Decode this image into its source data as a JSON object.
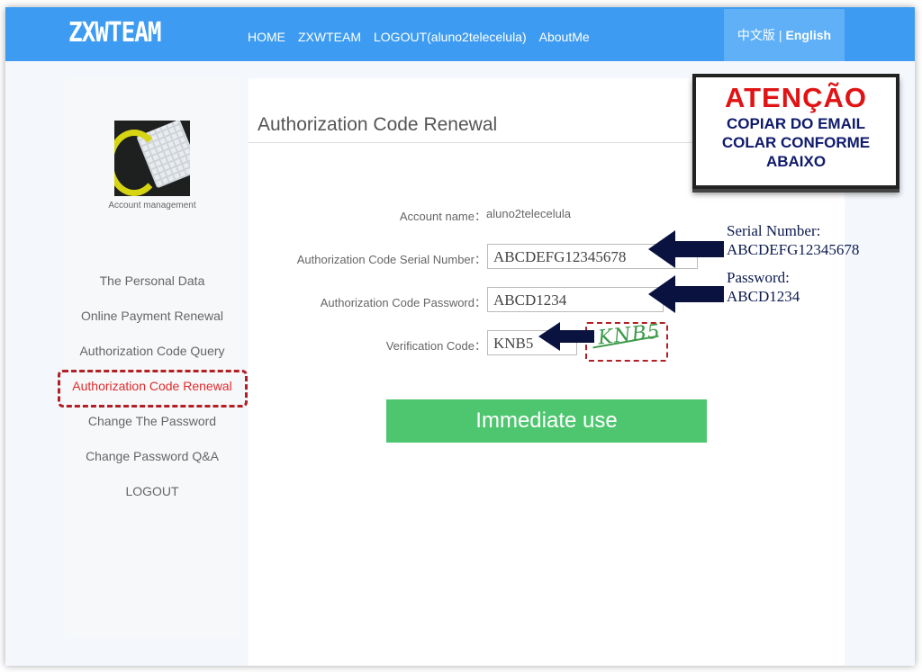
{
  "brand": "ZXWTEAM",
  "nav": {
    "home": "HOME",
    "zxwteam": "ZXWTEAM",
    "logout": "LOGOUT(aluno2telecelula)",
    "about": "AboutMe"
  },
  "lang": {
    "chinese": "中文版",
    "separator": "|",
    "english": "English"
  },
  "sidebar": {
    "avatar_label": "Account management",
    "items": [
      {
        "label": "The Personal Data"
      },
      {
        "label": "Online Payment Renewal"
      },
      {
        "label": "Authorization Code Query"
      },
      {
        "label": "Authorization Code Renewal",
        "active": true
      },
      {
        "label": "Change The Password"
      },
      {
        "label": "Change Password Q&A"
      },
      {
        "label": "LOGOUT"
      }
    ]
  },
  "main": {
    "title": "Authorization Code Renewal",
    "account_label": "Account name：",
    "account_value": "aluno2telecelula",
    "serial_label": "Authorization Code Serial Number：",
    "serial_value": "ABCDEFG12345678",
    "password_label": "Authorization Code Password：",
    "password_value": "ABCD1234",
    "verification_label": "Verification Code：",
    "verification_value": "KNB5",
    "captcha_text": "KNB5",
    "submit_label": "Immediate use"
  },
  "annotation": {
    "title": "ATENÇÃO",
    "line1": "COPIAR DO EMAIL",
    "line2": "COLAR CONFORME",
    "line3": "ABAIXO",
    "serial_note_label": "Serial Number:",
    "serial_note_value": "ABCDEFG12345678",
    "password_note_label": "Password:",
    "password_note_value": "ABCD1234"
  },
  "colors": {
    "topbar": "#3d9cf2",
    "active_menu": "#e12b2b",
    "submit": "#4dc66f",
    "attention_red": "#e01414",
    "arrow_navy": "#0a1240"
  }
}
